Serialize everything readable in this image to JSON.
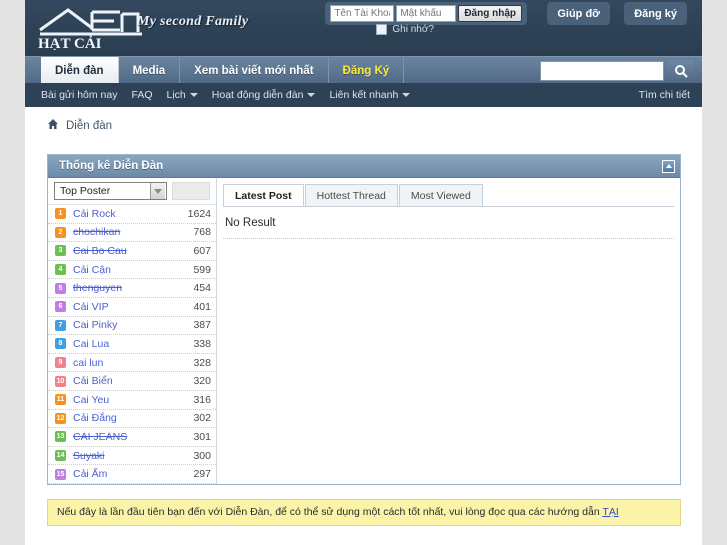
{
  "site": {
    "logo_text": "HẠT CẢI",
    "tagline": "My second Family"
  },
  "login": {
    "username_placeholder": "Tên Tài Khoản",
    "password_placeholder": "Mật khẩu",
    "submit_label": "Đăng nhập",
    "remember_label": "Ghi nhớ?",
    "help_label": "Giúp đỡ",
    "register_label": "Đăng ký"
  },
  "nav": {
    "tabs": [
      {
        "label": "Diễn đàn",
        "state": "active"
      },
      {
        "label": "Media",
        "state": "normal"
      },
      {
        "label": "Xem bài viết mới nhất",
        "state": "normal"
      },
      {
        "label": "Đăng Ký",
        "state": "highlight"
      }
    ],
    "search_value": "",
    "search_icon": "search-icon",
    "detail_link": "Tìm chi tiết"
  },
  "subnav": {
    "items": [
      {
        "label": "Bài gửi hôm nay",
        "has_caret": false
      },
      {
        "label": "FAQ",
        "has_caret": false
      },
      {
        "label": "Lịch",
        "has_caret": true
      },
      {
        "label": "Hoạt động diễn đàn",
        "has_caret": true
      },
      {
        "label": "Liên kết nhanh",
        "has_caret": true
      }
    ]
  },
  "breadcrumb": {
    "home_icon": "home-icon",
    "label": "Diễn đàn"
  },
  "panel": {
    "title": "Thống kê Diễn Đàn",
    "collapse_icon": "chevron-up-icon",
    "selector_value": "Top Poster",
    "top_posters": [
      {
        "rank": "1",
        "name": "Cải Rock",
        "count": "1624",
        "struck": false,
        "color": "#f59222"
      },
      {
        "rank": "2",
        "name": "chochikan",
        "count": "768",
        "struck": true,
        "color": "#f59222"
      },
      {
        "rank": "3",
        "name": "Cai Bo Cau",
        "count": "607",
        "struck": true,
        "color": "#6cbf52"
      },
      {
        "rank": "4",
        "name": "Cải Cận",
        "count": "599",
        "struck": false,
        "color": "#6cbf52"
      },
      {
        "rank": "5",
        "name": "thenguyen",
        "count": "454",
        "struck": true,
        "color": "#c07fe0"
      },
      {
        "rank": "6",
        "name": "Cải VIP",
        "count": "401",
        "struck": false,
        "color": "#c07fe0"
      },
      {
        "rank": "7",
        "name": "Cai Pinky",
        "count": "387",
        "struck": false,
        "color": "#3ea0e0"
      },
      {
        "rank": "8",
        "name": "Cai Lua",
        "count": "338",
        "struck": false,
        "color": "#3ea0e0"
      },
      {
        "rank": "9",
        "name": "cai lun",
        "count": "328",
        "struck": false,
        "color": "#f0828f"
      },
      {
        "rank": "10",
        "name": "Cải Biển",
        "count": "320",
        "struck": false,
        "color": "#f0828f"
      },
      {
        "rank": "11",
        "name": "Cai Yeu",
        "count": "316",
        "struck": false,
        "color": "#f59222"
      },
      {
        "rank": "12",
        "name": "Cải Đắng",
        "count": "302",
        "struck": false,
        "color": "#f59222"
      },
      {
        "rank": "13",
        "name": "CAI JEANS",
        "count": "301",
        "struck": true,
        "color": "#6cbf52"
      },
      {
        "rank": "14",
        "name": "Suyaki",
        "count": "300",
        "struck": true,
        "color": "#6cbf52"
      },
      {
        "rank": "15",
        "name": "Cải Ấm",
        "count": "297",
        "struck": false,
        "color": "#c07fe0"
      }
    ],
    "tabs": [
      {
        "label": "Latest Post",
        "active": true
      },
      {
        "label": "Hottest Thread",
        "active": false
      },
      {
        "label": "Most Viewed",
        "active": false
      }
    ],
    "empty_text": "No Result"
  },
  "notice": {
    "text_before": "Nếu đây là lần đầu tiên bạn đến với Diễn Đàn, để có thể sử dụng một cách tốt nhất, vui lòng đọc qua các hướng dẫn ",
    "link_text": "TẠI"
  }
}
